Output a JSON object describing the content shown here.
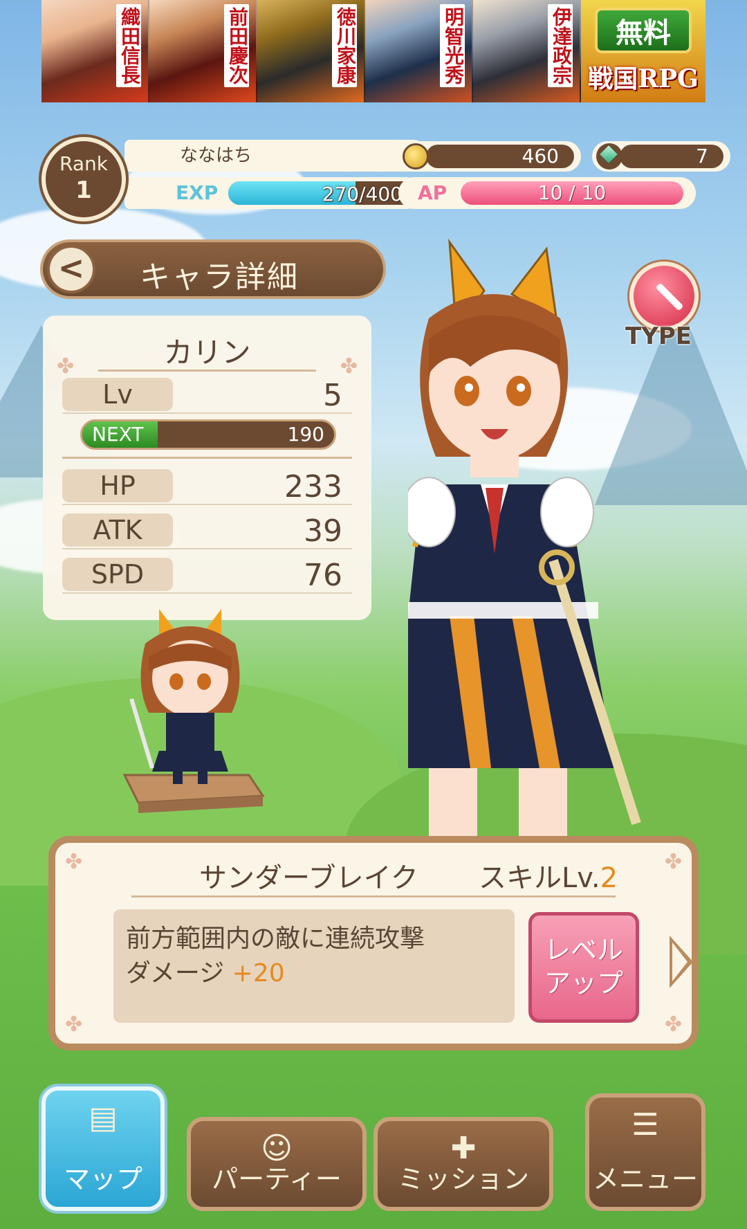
{
  "ad": {
    "names": [
      "織田信長",
      "前田慶次",
      "徳川家康",
      "明智光秀",
      "伊達政宗"
    ],
    "free_label": "無料",
    "rpg_label": "戦国RPG"
  },
  "player": {
    "rank_label": "Rank",
    "rank": "1",
    "name": "ななはち",
    "exp_label": "EXP",
    "exp_text": "270/400",
    "exp_fraction": 0.675,
    "coins": "460",
    "gems": "7",
    "ap_label": "AP",
    "ap_text": "10 / 10",
    "ap_fraction": 1.0
  },
  "header": {
    "back_symbol": "<",
    "title": "キャラ詳細"
  },
  "character": {
    "name": "カリン",
    "type_label": "TYPE",
    "type_icon": "sword-icon",
    "stats": [
      {
        "label": "Lv",
        "value": "5"
      },
      {
        "label": "HP",
        "value": "233"
      },
      {
        "label": "ATK",
        "value": "39"
      },
      {
        "label": "SPD",
        "value": "76"
      }
    ],
    "next_label": "NEXT",
    "next_value": "190",
    "next_fraction": 0.3
  },
  "skill": {
    "name": "サンダーブレイク",
    "level_prefix": "スキルLv.",
    "level": "2",
    "description_line1": "前方範囲内の敵に連続攻撃",
    "description_line2": "ダメージ",
    "description_bonus": "+20",
    "levelup_line1": "レベル",
    "levelup_line2": "アップ"
  },
  "nav": {
    "map": "マップ",
    "party": "パーティー",
    "mission": "ミッション",
    "menu": "メニュー"
  },
  "colors": {
    "brown": "#6b4a31",
    "exp": "#2bb4d8",
    "ap": "#ee4f7a",
    "next": "#2c8a22",
    "accent_orange": "#e58a1d"
  }
}
